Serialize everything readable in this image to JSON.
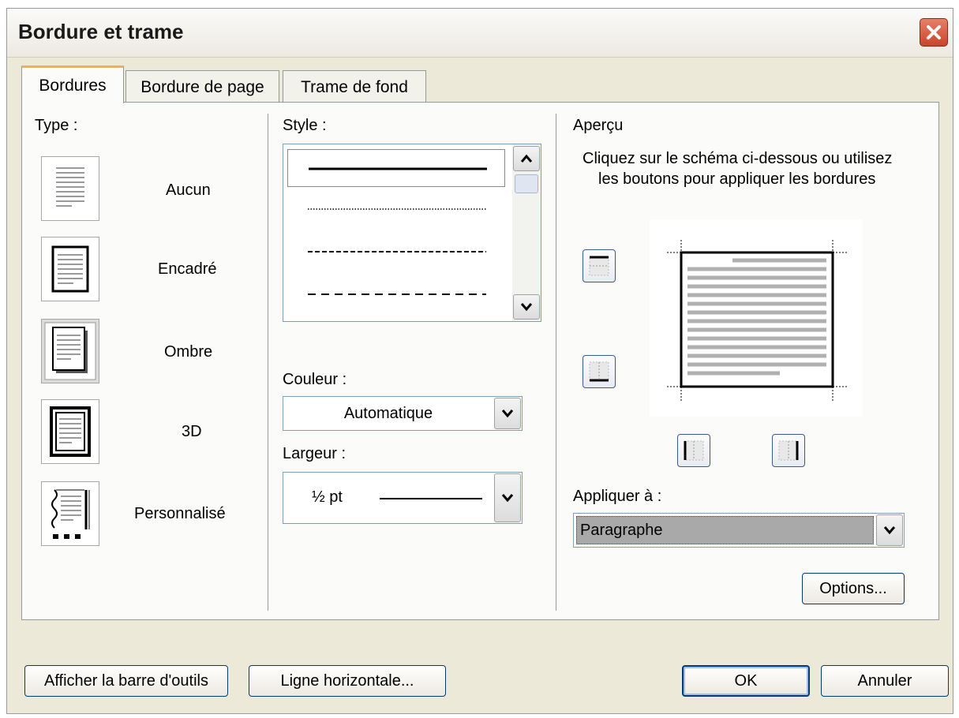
{
  "window": {
    "title": "Bordure et trame"
  },
  "tabs": [
    {
      "label": "Bordures"
    },
    {
      "label": "Bordure de page"
    },
    {
      "label": "Trame de fond"
    }
  ],
  "type_section": {
    "label": "Type :",
    "options": [
      {
        "label": "Aucun",
        "icon": "none-border-icon"
      },
      {
        "label": "Encadré",
        "icon": "box-border-icon"
      },
      {
        "label": "Ombre",
        "icon": "shadow-border-icon"
      },
      {
        "label": "3D",
        "icon": "3d-border-icon"
      },
      {
        "label": "Personnalisé",
        "icon": "custom-border-icon"
      }
    ]
  },
  "style_section": {
    "label": "Style :",
    "styles": [
      "solid",
      "dotted",
      "dashed",
      "long-dashed"
    ]
  },
  "color": {
    "label": "Couleur :",
    "value": "Automatique"
  },
  "width": {
    "label": "Largeur :",
    "value": "½ pt"
  },
  "preview": {
    "label": "Aperçu",
    "instruction_line1": "Cliquez sur le schéma ci-dessous ou utilisez",
    "instruction_line2": "les boutons pour appliquer les bordures"
  },
  "apply_to": {
    "label": "Appliquer à :",
    "value": "Paragraphe"
  },
  "buttons": {
    "options": "Options...",
    "toolbar": "Afficher la barre d'outils",
    "horizontal_line": "Ligne horizontale...",
    "ok": "OK",
    "cancel": "Annuler"
  },
  "colors": {
    "dialog_bg": "#ECE9D8",
    "tab_highlight": "#F4B04E",
    "close_button": "#C9452A",
    "selection": "#A9A9A9"
  }
}
